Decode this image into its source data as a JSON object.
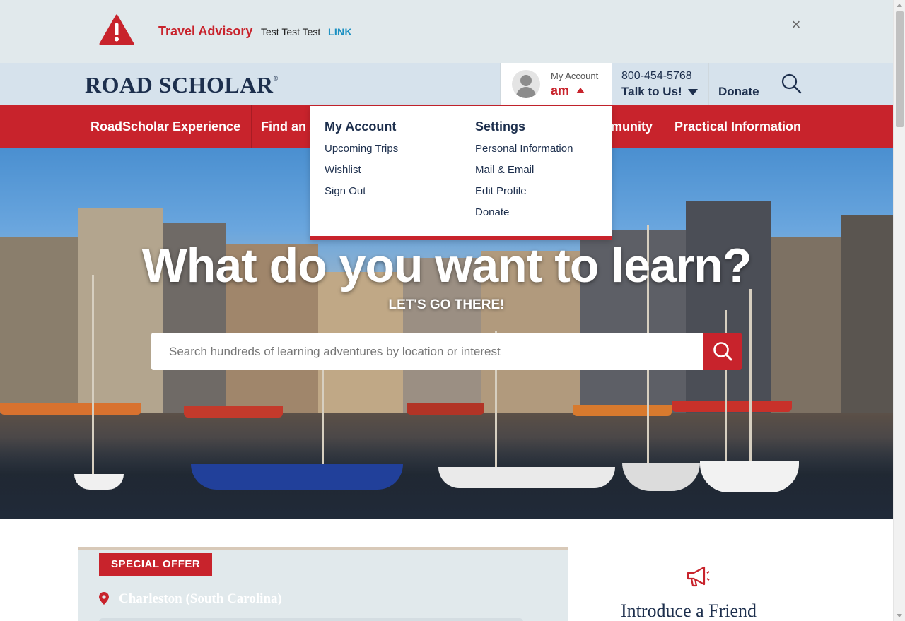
{
  "advisory": {
    "title": "Travel Advisory",
    "text": "Test Test Test",
    "link": "LINK",
    "close_icon": "close-icon"
  },
  "header": {
    "logo_text": "ROAD SCHOLAR",
    "logo_reg": "®",
    "account_label": "My Account",
    "account_user": "am",
    "phone_number": "800-454-5768",
    "talk_label": "Talk to Us!",
    "donate_label": "Donate"
  },
  "nav": {
    "items": [
      {
        "label": "RoadScholar Experience"
      },
      {
        "label": "Find an Adventure"
      },
      {
        "label": "Community"
      },
      {
        "label": "Practical Information"
      }
    ]
  },
  "dropdown": {
    "account_heading": "My Account",
    "account_links": [
      "Upcoming Trips",
      "Wishlist",
      "Sign Out"
    ],
    "settings_heading": "Settings",
    "settings_links": [
      "Personal Information",
      "Mail & Email",
      "Edit Profile",
      "Donate"
    ]
  },
  "hero": {
    "heading": "What do you want to learn?",
    "tagline": "LET'S GO THERE!",
    "search_placeholder": "Search hundreds of learning adventures by location or interest"
  },
  "offer": {
    "badge": "SPECIAL OFFER",
    "location": "Charleston (South Carolina)"
  },
  "friend": {
    "title": "Introduce a Friend"
  },
  "colors": {
    "brand_red": "#c8232c",
    "navy": "#1d2f4d",
    "advisory_bg": "#e1e9ec",
    "link_blue": "#1a8fc1"
  }
}
